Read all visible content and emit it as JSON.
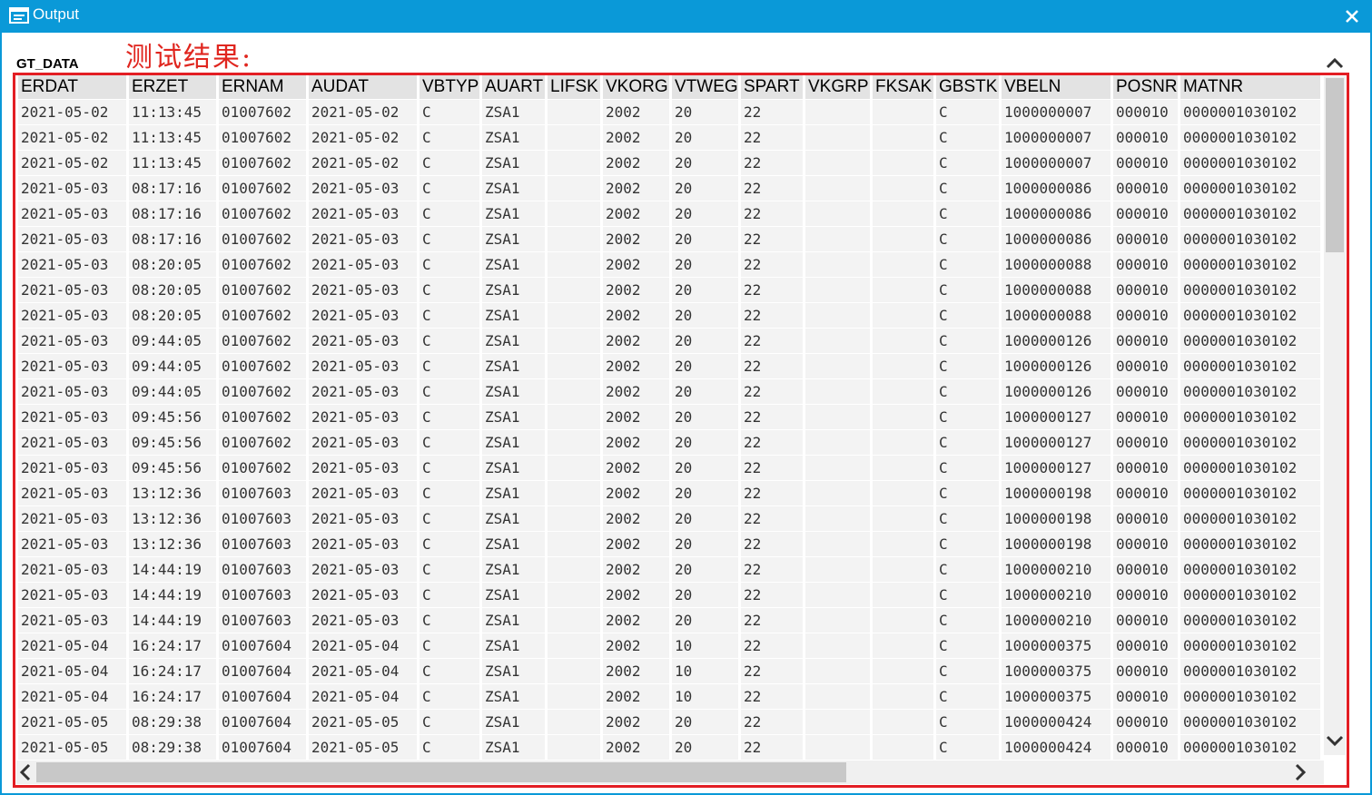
{
  "window": {
    "title": "Output"
  },
  "list_name": "GT_DATA",
  "annotation": "测试结果:",
  "table": {
    "columns": [
      "ERDAT",
      "ERZET",
      "ERNAM",
      "AUDAT",
      "VBTYP",
      "AUART",
      "LIFSK",
      "VKORG",
      "VTWEG",
      "SPART",
      "VKGRP",
      "FKSAK",
      "GBSTK",
      "VBELN",
      "POSNR",
      "MATNR"
    ],
    "rows": [
      [
        "2021-05-02",
        "11:13:45",
        "01007602",
        "2021-05-02",
        "C",
        "ZSA1",
        "",
        "2002",
        "20",
        "22",
        "",
        "",
        "C",
        "1000000007",
        "000010",
        "0000001030102"
      ],
      [
        "2021-05-02",
        "11:13:45",
        "01007602",
        "2021-05-02",
        "C",
        "ZSA1",
        "",
        "2002",
        "20",
        "22",
        "",
        "",
        "C",
        "1000000007",
        "000010",
        "0000001030102"
      ],
      [
        "2021-05-02",
        "11:13:45",
        "01007602",
        "2021-05-02",
        "C",
        "ZSA1",
        "",
        "2002",
        "20",
        "22",
        "",
        "",
        "C",
        "1000000007",
        "000010",
        "0000001030102"
      ],
      [
        "2021-05-03",
        "08:17:16",
        "01007602",
        "2021-05-03",
        "C",
        "ZSA1",
        "",
        "2002",
        "20",
        "22",
        "",
        "",
        "C",
        "1000000086",
        "000010",
        "0000001030102"
      ],
      [
        "2021-05-03",
        "08:17:16",
        "01007602",
        "2021-05-03",
        "C",
        "ZSA1",
        "",
        "2002",
        "20",
        "22",
        "",
        "",
        "C",
        "1000000086",
        "000010",
        "0000001030102"
      ],
      [
        "2021-05-03",
        "08:17:16",
        "01007602",
        "2021-05-03",
        "C",
        "ZSA1",
        "",
        "2002",
        "20",
        "22",
        "",
        "",
        "C",
        "1000000086",
        "000010",
        "0000001030102"
      ],
      [
        "2021-05-03",
        "08:20:05",
        "01007602",
        "2021-05-03",
        "C",
        "ZSA1",
        "",
        "2002",
        "20",
        "22",
        "",
        "",
        "C",
        "1000000088",
        "000010",
        "0000001030102"
      ],
      [
        "2021-05-03",
        "08:20:05",
        "01007602",
        "2021-05-03",
        "C",
        "ZSA1",
        "",
        "2002",
        "20",
        "22",
        "",
        "",
        "C",
        "1000000088",
        "000010",
        "0000001030102"
      ],
      [
        "2021-05-03",
        "08:20:05",
        "01007602",
        "2021-05-03",
        "C",
        "ZSA1",
        "",
        "2002",
        "20",
        "22",
        "",
        "",
        "C",
        "1000000088",
        "000010",
        "0000001030102"
      ],
      [
        "2021-05-03",
        "09:44:05",
        "01007602",
        "2021-05-03",
        "C",
        "ZSA1",
        "",
        "2002",
        "20",
        "22",
        "",
        "",
        "C",
        "1000000126",
        "000010",
        "0000001030102"
      ],
      [
        "2021-05-03",
        "09:44:05",
        "01007602",
        "2021-05-03",
        "C",
        "ZSA1",
        "",
        "2002",
        "20",
        "22",
        "",
        "",
        "C",
        "1000000126",
        "000010",
        "0000001030102"
      ],
      [
        "2021-05-03",
        "09:44:05",
        "01007602",
        "2021-05-03",
        "C",
        "ZSA1",
        "",
        "2002",
        "20",
        "22",
        "",
        "",
        "C",
        "1000000126",
        "000010",
        "0000001030102"
      ],
      [
        "2021-05-03",
        "09:45:56",
        "01007602",
        "2021-05-03",
        "C",
        "ZSA1",
        "",
        "2002",
        "20",
        "22",
        "",
        "",
        "C",
        "1000000127",
        "000010",
        "0000001030102"
      ],
      [
        "2021-05-03",
        "09:45:56",
        "01007602",
        "2021-05-03",
        "C",
        "ZSA1",
        "",
        "2002",
        "20",
        "22",
        "",
        "",
        "C",
        "1000000127",
        "000010",
        "0000001030102"
      ],
      [
        "2021-05-03",
        "09:45:56",
        "01007602",
        "2021-05-03",
        "C",
        "ZSA1",
        "",
        "2002",
        "20",
        "22",
        "",
        "",
        "C",
        "1000000127",
        "000010",
        "0000001030102"
      ],
      [
        "2021-05-03",
        "13:12:36",
        "01007603",
        "2021-05-03",
        "C",
        "ZSA1",
        "",
        "2002",
        "20",
        "22",
        "",
        "",
        "C",
        "1000000198",
        "000010",
        "0000001030102"
      ],
      [
        "2021-05-03",
        "13:12:36",
        "01007603",
        "2021-05-03",
        "C",
        "ZSA1",
        "",
        "2002",
        "20",
        "22",
        "",
        "",
        "C",
        "1000000198",
        "000010",
        "0000001030102"
      ],
      [
        "2021-05-03",
        "13:12:36",
        "01007603",
        "2021-05-03",
        "C",
        "ZSA1",
        "",
        "2002",
        "20",
        "22",
        "",
        "",
        "C",
        "1000000198",
        "000010",
        "0000001030102"
      ],
      [
        "2021-05-03",
        "14:44:19",
        "01007603",
        "2021-05-03",
        "C",
        "ZSA1",
        "",
        "2002",
        "20",
        "22",
        "",
        "",
        "C",
        "1000000210",
        "000010",
        "0000001030102"
      ],
      [
        "2021-05-03",
        "14:44:19",
        "01007603",
        "2021-05-03",
        "C",
        "ZSA1",
        "",
        "2002",
        "20",
        "22",
        "",
        "",
        "C",
        "1000000210",
        "000010",
        "0000001030102"
      ],
      [
        "2021-05-03",
        "14:44:19",
        "01007603",
        "2021-05-03",
        "C",
        "ZSA1",
        "",
        "2002",
        "20",
        "22",
        "",
        "",
        "C",
        "1000000210",
        "000010",
        "0000001030102"
      ],
      [
        "2021-05-04",
        "16:24:17",
        "01007604",
        "2021-05-04",
        "C",
        "ZSA1",
        "",
        "2002",
        "10",
        "22",
        "",
        "",
        "C",
        "1000000375",
        "000010",
        "0000001030102"
      ],
      [
        "2021-05-04",
        "16:24:17",
        "01007604",
        "2021-05-04",
        "C",
        "ZSA1",
        "",
        "2002",
        "10",
        "22",
        "",
        "",
        "C",
        "1000000375",
        "000010",
        "0000001030102"
      ],
      [
        "2021-05-04",
        "16:24:17",
        "01007604",
        "2021-05-04",
        "C",
        "ZSA1",
        "",
        "2002",
        "10",
        "22",
        "",
        "",
        "C",
        "1000000375",
        "000010",
        "0000001030102"
      ],
      [
        "2021-05-05",
        "08:29:38",
        "01007604",
        "2021-05-05",
        "C",
        "ZSA1",
        "",
        "2002",
        "20",
        "22",
        "",
        "",
        "C",
        "1000000424",
        "000010",
        "0000001030102"
      ],
      [
        "2021-05-05",
        "08:29:38",
        "01007604",
        "2021-05-05",
        "C",
        "ZSA1",
        "",
        "2002",
        "20",
        "22",
        "",
        "",
        "C",
        "1000000424",
        "000010",
        "0000001030102"
      ]
    ]
  },
  "icons": {
    "window": "list-output-icon",
    "close": "close-icon",
    "scroll_up": "chevron-up-icon",
    "scroll_down": "chevron-down-icon",
    "scroll_left": "chevron-left-icon",
    "scroll_right": "chevron-right-icon"
  },
  "colors": {
    "titlebar": "#0a99d8",
    "annotation": "#e31e24",
    "header_bg": "#e3e3e3",
    "cell_bg": "#f3f3f3"
  }
}
